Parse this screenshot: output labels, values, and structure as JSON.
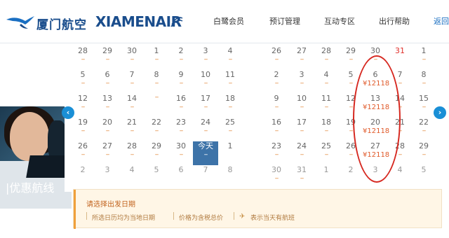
{
  "header": {
    "logo_cn": "厦门航空",
    "logo_en": "XIAMENAIR",
    "nav": [
      "白鹭会员",
      "预订管理",
      "互动专区",
      "出行帮助",
      "返回"
    ]
  },
  "banner": {
    "text": "|优惠航线"
  },
  "left_month": [
    [
      {
        "d": "28",
        "dash": "--"
      },
      {
        "d": "29",
        "dash": "--"
      },
      {
        "d": "30",
        "dash": "--"
      },
      {
        "d": "1",
        "dash": "--"
      },
      {
        "d": "2",
        "dash": "--"
      },
      {
        "d": "3",
        "dash": "--"
      },
      {
        "d": "4",
        "dash": "--"
      }
    ],
    [
      {
        "d": "5",
        "dash": "--"
      },
      {
        "d": "6",
        "dash": "--"
      },
      {
        "d": "7",
        "dash": "--"
      },
      {
        "d": "8",
        "dash": "--"
      },
      {
        "d": "9",
        "dash": "--"
      },
      {
        "d": "10",
        "dash": "--"
      },
      {
        "d": "11",
        "dash": "--"
      }
    ],
    [
      {
        "d": "12",
        "dash": "--"
      },
      {
        "d": "13",
        "dash": "--"
      },
      {
        "d": "14",
        "dash": "--"
      },
      {
        "d": "",
        "dash": "--"
      },
      {
        "d": "16",
        "dash": "--"
      },
      {
        "d": "17",
        "dash": "--"
      },
      {
        "d": "18",
        "dash": "--"
      }
    ],
    [
      {
        "d": "19",
        "dash": "--"
      },
      {
        "d": "20",
        "dash": "--"
      },
      {
        "d": "21",
        "dash": "--"
      },
      {
        "d": "22",
        "dash": "--"
      },
      {
        "d": "23",
        "dash": "--"
      },
      {
        "d": "24",
        "dash": "--"
      },
      {
        "d": "25",
        "dash": "--"
      }
    ],
    [
      {
        "d": "26",
        "dash": "--"
      },
      {
        "d": "27",
        "dash": "--"
      },
      {
        "d": "28",
        "dash": "--"
      },
      {
        "d": "29",
        "dash": "--"
      },
      {
        "d": "30",
        "dash": "--"
      },
      {
        "d": "今天",
        "dash": "--",
        "today": true
      },
      {
        "d": "1",
        "dash": ""
      }
    ],
    [
      {
        "d": "2",
        "dash": ""
      },
      {
        "d": "3",
        "dash": ""
      },
      {
        "d": "4",
        "dash": ""
      },
      {
        "d": "5",
        "dash": ""
      },
      {
        "d": "6",
        "dash": ""
      },
      {
        "d": "7",
        "dash": ""
      },
      {
        "d": "8",
        "dash": ""
      }
    ]
  ],
  "right_month": [
    [
      {
        "d": "26",
        "dash": "--"
      },
      {
        "d": "27",
        "dash": "--"
      },
      {
        "d": "28",
        "dash": "--"
      },
      {
        "d": "29",
        "dash": "--"
      },
      {
        "d": "30",
        "dash": "--"
      },
      {
        "d": "31",
        "dash": "",
        "red": true
      },
      {
        "d": "1",
        "dash": "--"
      }
    ],
    [
      {
        "d": "2",
        "dash": "--"
      },
      {
        "d": "3",
        "dash": "--"
      },
      {
        "d": "4",
        "dash": "--"
      },
      {
        "d": "5",
        "dash": "--"
      },
      {
        "d": "6",
        "price": "¥12118"
      },
      {
        "d": "7",
        "dash": "--"
      },
      {
        "d": "8",
        "dash": "--"
      }
    ],
    [
      {
        "d": "9",
        "dash": "--"
      },
      {
        "d": "10",
        "dash": "--"
      },
      {
        "d": "11",
        "dash": "--"
      },
      {
        "d": "12",
        "dash": "--"
      },
      {
        "d": "13",
        "price": "¥12118"
      },
      {
        "d": "14",
        "dash": "--"
      },
      {
        "d": "15",
        "dash": "--"
      }
    ],
    [
      {
        "d": "16",
        "dash": "--"
      },
      {
        "d": "17",
        "dash": "--"
      },
      {
        "d": "18",
        "dash": "--"
      },
      {
        "d": "19",
        "dash": "--"
      },
      {
        "d": "20",
        "price": "¥12118"
      },
      {
        "d": "21",
        "dash": "--"
      },
      {
        "d": "22",
        "dash": "--"
      }
    ],
    [
      {
        "d": "23",
        "dash": "--"
      },
      {
        "d": "24",
        "dash": "--"
      },
      {
        "d": "25",
        "dash": "--"
      },
      {
        "d": "26",
        "dash": "--"
      },
      {
        "d": "27",
        "price": "¥12118"
      },
      {
        "d": "28",
        "dash": "--"
      },
      {
        "d": "29",
        "dash": "--"
      }
    ],
    [
      {
        "d": "30",
        "dash": "--"
      },
      {
        "d": "31",
        "dash": "--"
      },
      {
        "d": "1",
        "dash": ""
      },
      {
        "d": "2",
        "dash": ""
      },
      {
        "d": "3",
        "dash": ""
      },
      {
        "d": "4",
        "dash": ""
      },
      {
        "d": "5",
        "dash": ""
      }
    ]
  ],
  "notice": {
    "title": "请选择出发日期",
    "tip1": "所选日历均为当地日期",
    "tip2": "价格为含税总价",
    "tip3": "表示当天有航班"
  },
  "arrows": {
    "prev": "‹",
    "next": "›"
  }
}
